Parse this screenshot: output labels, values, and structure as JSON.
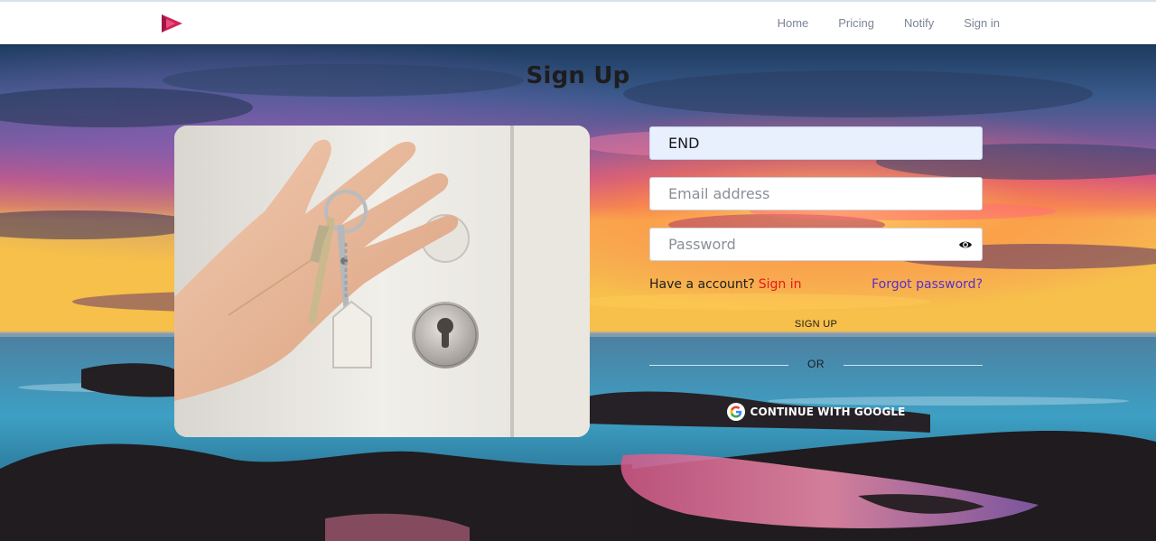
{
  "nav": {
    "logo": "play-logo-icon",
    "links": [
      "Home",
      "Pricing",
      "Notify",
      "Sign in"
    ]
  },
  "page": {
    "title": "Sign Up"
  },
  "form": {
    "name_value": "END",
    "email_placeholder": "Email address",
    "password_placeholder": "Password",
    "have_account": "Have a account?",
    "signin_link": "Sign in",
    "forgot_link": "Forgot password?",
    "signup_button": "SIGN UP",
    "or_text": "OR",
    "google_button": "CONTINUE WITH GOOGLE"
  },
  "colors": {
    "accent": "#e6191a",
    "link": "#5a2ec9",
    "logo": "#d0245c",
    "filled_input": "#e8f0fe"
  },
  "icons": [
    "play-logo-icon",
    "eye-icon",
    "google-icon"
  ]
}
